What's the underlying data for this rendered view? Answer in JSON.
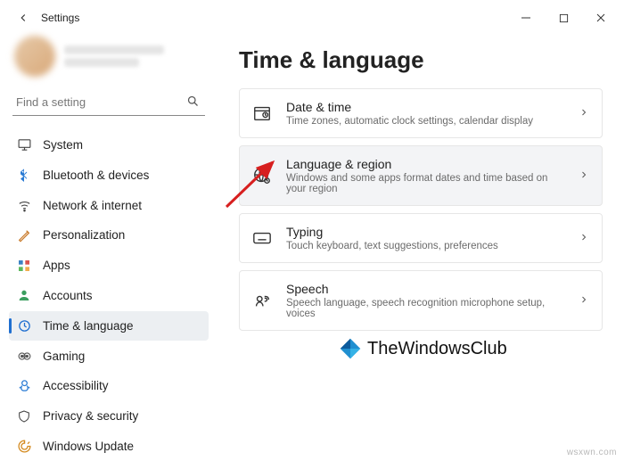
{
  "window": {
    "title": "Settings",
    "footer_domain": "wsxwn.com"
  },
  "sidebar": {
    "search_placeholder": "Find a setting",
    "items": [
      {
        "label": "System"
      },
      {
        "label": "Bluetooth & devices"
      },
      {
        "label": "Network & internet"
      },
      {
        "label": "Personalization"
      },
      {
        "label": "Apps"
      },
      {
        "label": "Accounts"
      },
      {
        "label": "Time & language"
      },
      {
        "label": "Gaming"
      },
      {
        "label": "Accessibility"
      },
      {
        "label": "Privacy & security"
      },
      {
        "label": "Windows Update"
      }
    ],
    "selected_index": 6
  },
  "page": {
    "title": "Time & language",
    "cards": [
      {
        "title": "Date & time",
        "desc": "Time zones, automatic clock settings, calendar display"
      },
      {
        "title": "Language & region",
        "desc": "Windows and some apps format dates and time based on your region",
        "highlight": true
      },
      {
        "title": "Typing",
        "desc": "Touch keyboard, text suggestions, preferences"
      },
      {
        "title": "Speech",
        "desc": "Speech language, speech recognition microphone setup, voices"
      }
    ]
  },
  "watermark": {
    "text": "TheWindowsClub"
  }
}
